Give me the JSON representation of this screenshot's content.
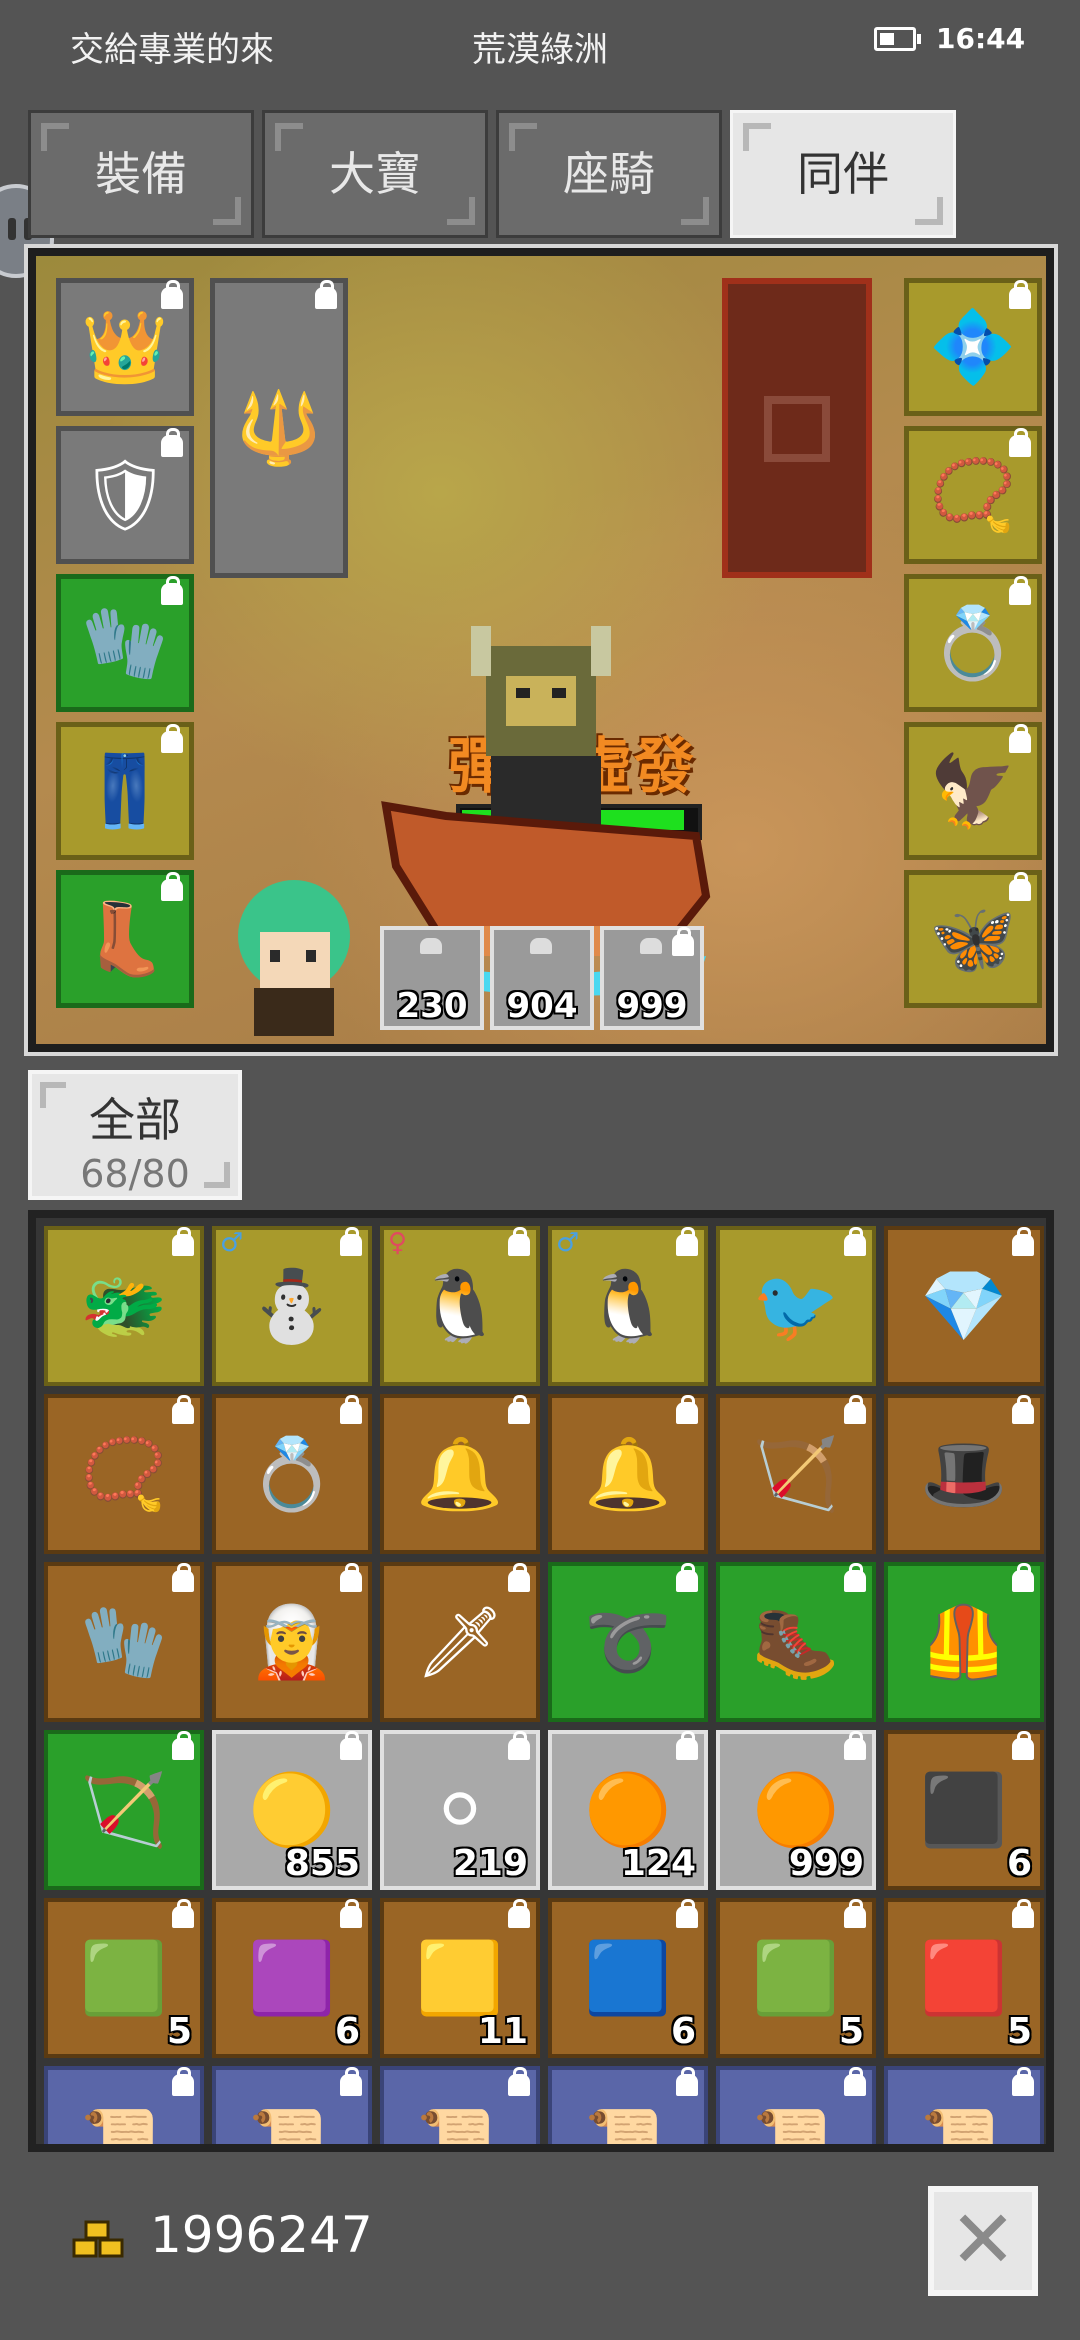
{
  "status_bar": {
    "left_text": "交給專業的來",
    "center_text": "荒漠綠洲",
    "time": "16:44"
  },
  "tabs": [
    {
      "label": "裝備",
      "active": false
    },
    {
      "label": "大寶",
      "active": false
    },
    {
      "label": "座騎",
      "active": false
    },
    {
      "label": "同伴",
      "active": true
    }
  ],
  "equipment": {
    "skill_name": "彈無虛發",
    "hp_fraction": 0.95,
    "potions": [
      {
        "count": "230"
      },
      {
        "count": "904"
      },
      {
        "count": "999"
      }
    ]
  },
  "category": {
    "label": "全部",
    "count": "68/80"
  },
  "inventory": {
    "rows": [
      [
        {
          "color": "y",
          "icon": "dragon-portrait-icon",
          "glyph": "🐲"
        },
        {
          "color": "y",
          "icon": "snowman-portrait-icon",
          "glyph": "⛄",
          "mark": "♂",
          "mark_color": "#4aa0e0"
        },
        {
          "color": "y",
          "icon": "penguin-portrait-icon",
          "glyph": "🐧",
          "mark": "♀",
          "mark_color": "#e04a60"
        },
        {
          "color": "y",
          "icon": "penguin-portrait-icon",
          "glyph": "🐧",
          "mark": "♂",
          "mark_color": "#4aa0e0"
        },
        {
          "color": "y",
          "icon": "phoenix-portrait-icon",
          "glyph": "🐦"
        },
        {
          "color": "brown",
          "icon": "blue-gem-amulet-icon",
          "glyph": "💎"
        }
      ],
      [
        {
          "color": "brown",
          "icon": "ruby-necklace-icon",
          "glyph": "📿"
        },
        {
          "color": "brown",
          "icon": "ruby-ring-icon",
          "glyph": "💍"
        },
        {
          "color": "brown",
          "icon": "gold-earring-icon",
          "glyph": "🔔"
        },
        {
          "color": "brown",
          "icon": "gold-earring-icon",
          "glyph": "🔔"
        },
        {
          "color": "brown",
          "icon": "bow-icon",
          "glyph": "🏹"
        },
        {
          "color": "brown",
          "icon": "red-hat-icon",
          "glyph": "🎩"
        }
      ],
      [
        {
          "color": "brown",
          "icon": "red-glove-icon",
          "glyph": "🧤"
        },
        {
          "color": "brown",
          "icon": "warrior-portrait-icon",
          "glyph": "🧝"
        },
        {
          "color": "brown",
          "icon": "dagger-icon",
          "glyph": "🗡"
        },
        {
          "color": "g",
          "icon": "belt-icon",
          "glyph": "➰"
        },
        {
          "color": "g",
          "icon": "boots-icon",
          "glyph": "🥾"
        },
        {
          "color": "g",
          "icon": "armor-icon",
          "glyph": "🦺"
        }
      ],
      [
        {
          "color": "g",
          "icon": "ice-bow-icon",
          "glyph": "🏹"
        },
        {
          "color": "gray",
          "icon": "gold-ore-icon",
          "glyph": "🟡",
          "count": "855"
        },
        {
          "color": "gray",
          "icon": "iron-ore-icon",
          "glyph": "⚪",
          "count": "219"
        },
        {
          "color": "gray",
          "icon": "copper-ore-icon",
          "glyph": "🟠",
          "count": "124"
        },
        {
          "color": "gray",
          "icon": "copper-ore-icon",
          "glyph": "🟠",
          "count": "999"
        },
        {
          "color": "brown",
          "icon": "black-gem-icon",
          "glyph": "⬛",
          "count": "6"
        }
      ],
      [
        {
          "color": "brown",
          "icon": "pale-gem-icon",
          "glyph": "🟩",
          "count": "5"
        },
        {
          "color": "brown",
          "icon": "purple-gem-icon",
          "glyph": "🟪",
          "count": "6"
        },
        {
          "color": "brown",
          "icon": "yellow-gem-icon",
          "glyph": "🟨",
          "count": "11"
        },
        {
          "color": "brown",
          "icon": "blue-gem-icon",
          "glyph": "🟦",
          "count": "6"
        },
        {
          "color": "brown",
          "icon": "green-gem-icon",
          "glyph": "🟩",
          "count": "5"
        },
        {
          "color": "brown",
          "icon": "red-gem-icon",
          "glyph": "🟥",
          "count": "5"
        }
      ],
      [
        {
          "color": "blue",
          "icon": "scroll-icon",
          "glyph": "📜"
        },
        {
          "color": "blue",
          "icon": "scroll-icon",
          "glyph": "📜"
        },
        {
          "color": "blue",
          "icon": "scroll-icon",
          "glyph": "📜"
        },
        {
          "color": "blue",
          "icon": "scroll-icon",
          "glyph": "📜"
        },
        {
          "color": "blue",
          "icon": "scroll-icon",
          "glyph": "📜"
        },
        {
          "color": "blue",
          "icon": "scroll-icon",
          "glyph": "📜"
        }
      ]
    ]
  },
  "footer": {
    "gold_amount": "1996247"
  }
}
